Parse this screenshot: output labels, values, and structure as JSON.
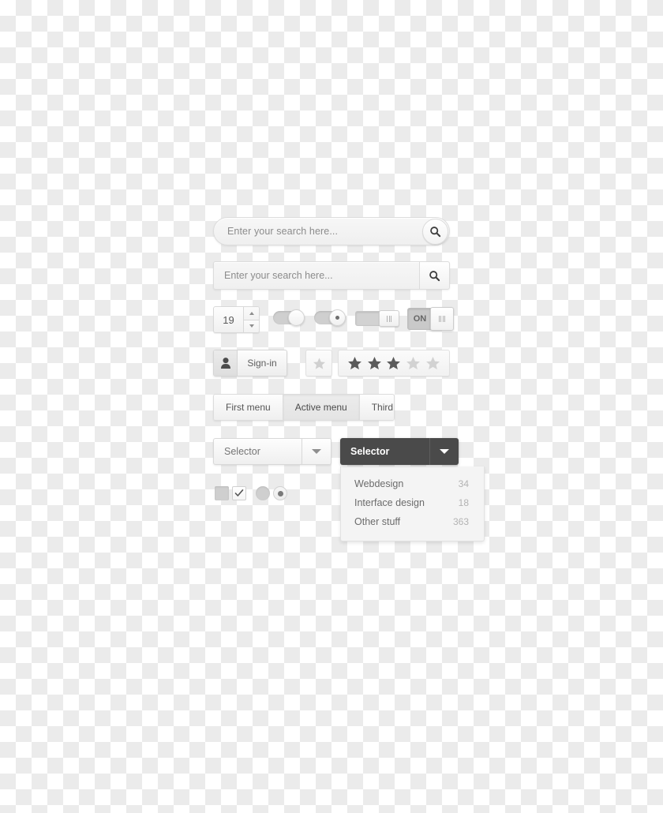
{
  "search_pill": {
    "placeholder": "Enter your search here...",
    "icon": "search-icon"
  },
  "search_rect": {
    "placeholder": "Enter your search here...",
    "icon": "search-icon"
  },
  "stepper": {
    "value": "19",
    "up_icon": "chevron-up-icon",
    "down_icon": "chevron-down-icon"
  },
  "toggles": {
    "switch_plain": {
      "state": "on",
      "icon": "toggle-knob"
    },
    "switch_dot": {
      "state": "on",
      "icon": "toggle-knob-dot"
    },
    "switch_slider": {
      "state": "on",
      "icon": "grip-handle"
    },
    "switch_on": {
      "label": "ON",
      "state": "on",
      "icon": "grip-handle"
    }
  },
  "signin": {
    "label": "Sign-in",
    "icon": "user-icon"
  },
  "rating_single": {
    "icon": "star-icon",
    "color": "#cfcfcf"
  },
  "rating_group": {
    "filled": 3,
    "total": 5,
    "icon": "star-icon",
    "filled_color": "#5b5b5b",
    "empty_color": "#d2d2d2"
  },
  "menu": {
    "tabs": [
      {
        "label": "First menu",
        "active": false
      },
      {
        "label": "Active menu",
        "active": true
      },
      {
        "label": "Third menu",
        "active": false
      }
    ]
  },
  "selector_light": {
    "label": "Selector",
    "arrow_icon": "caret-down-icon"
  },
  "selector_dark": {
    "label": "Selector",
    "arrow_icon": "caret-down-icon",
    "background": "#4a4a4a"
  },
  "dropdown": {
    "items": [
      {
        "label": "Webdesign",
        "count": "34"
      },
      {
        "label": "Interface design",
        "count": "18"
      },
      {
        "label": "Other stuff",
        "count": "363"
      }
    ]
  },
  "checkboxes": [
    {
      "name": "checkbox-unchecked",
      "checked": false
    },
    {
      "name": "checkbox-checked",
      "checked": true
    }
  ],
  "radios": [
    {
      "name": "radio-unselected",
      "selected": false
    },
    {
      "name": "radio-selected",
      "selected": true
    }
  ]
}
